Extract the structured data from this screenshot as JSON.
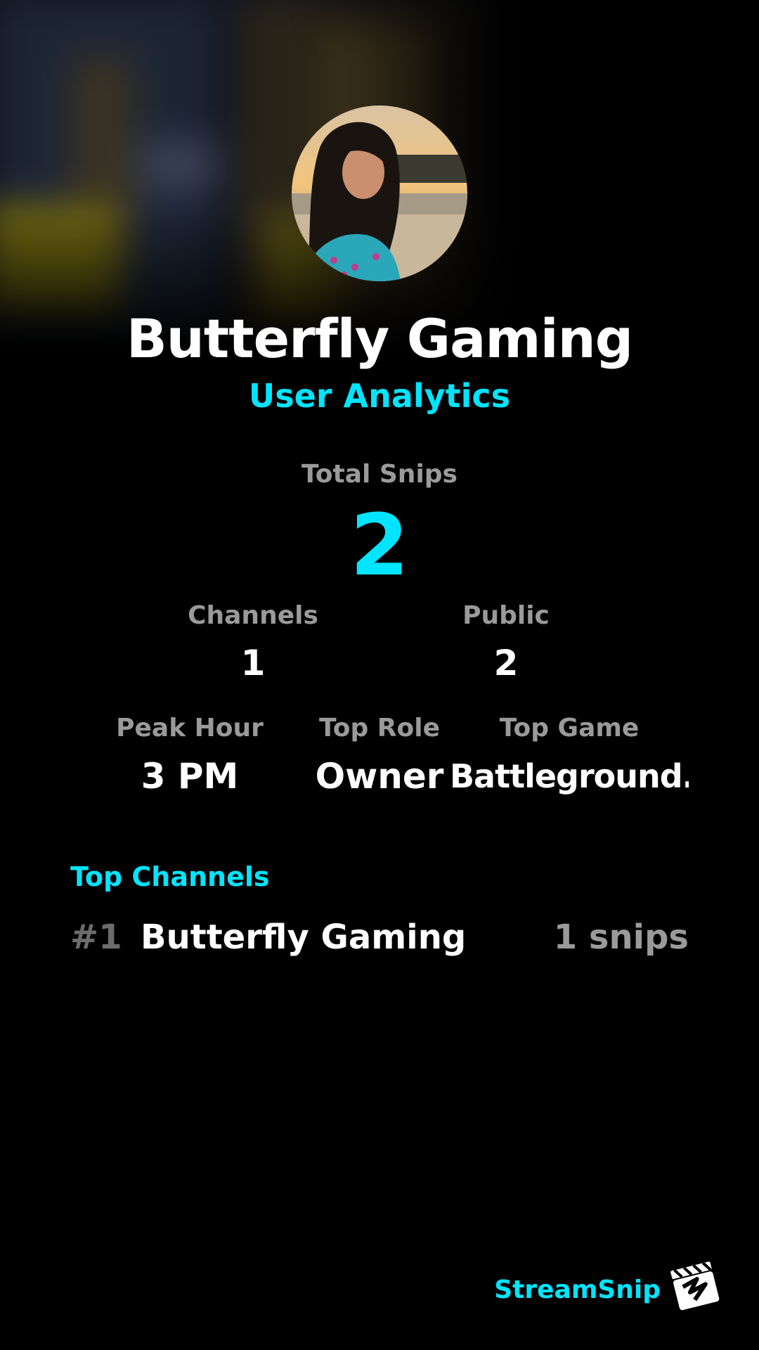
{
  "header": {
    "channel_name": "Butterfly Gaming",
    "subtitle": "User Analytics"
  },
  "stats": {
    "total_snips_label": "Total Snips",
    "total_snips_value": "2",
    "channels_label": "Channels",
    "channels_value": "1",
    "public_label": "Public",
    "public_value": "2",
    "peak_hour_label": "Peak Hour",
    "peak_hour_value": "3 PM",
    "top_role_label": "Top Role",
    "top_role_value": "Owner",
    "top_game_label": "Top Game",
    "top_game_value": "Battleground.."
  },
  "top_channels": {
    "title": "Top Channels",
    "items": [
      {
        "rank": "#1",
        "name": "Butterfly Gaming",
        "count": "1 snips"
      }
    ]
  },
  "brand": {
    "name": "StreamSnip"
  },
  "colors": {
    "accent": "#00e5ff",
    "label_gray": "#9a9a9a",
    "rank_gray": "#6c6c6c",
    "background": "#000000"
  },
  "icons": {
    "brand_logo": "clapperboard-icon",
    "avatar": "profile-photo"
  }
}
